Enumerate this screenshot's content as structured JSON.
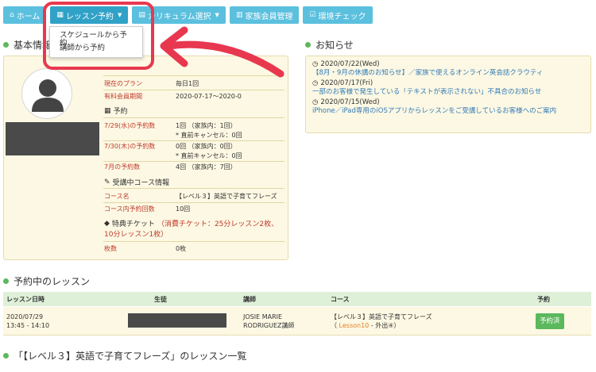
{
  "nav": {
    "home": "ホーム",
    "lesson_reservation": "レッスン予約",
    "curriculum": "カリキュラム選択",
    "family": "家族会員管理",
    "env_check": "環境チェック"
  },
  "dropdown": {
    "items": [
      "スケジュールから予約",
      "講師から予約"
    ]
  },
  "sections": {
    "basic_info": "基本情報",
    "news": "お知らせ",
    "upcoming": "予約中のレッスン",
    "lesson_list": "「【レベル３】英語で子育てフレーズ」のレッスン一覧"
  },
  "profile": {
    "plan_label": "現在のプラン",
    "plan_value": "毎日1回",
    "period_label": "有料会員期間",
    "period_value": "2020-07-17〜2020-0",
    "reservation_heading": "予約",
    "r1_label": "7/29(水)の予約数",
    "r1_value": "1回 （家族内：1回）",
    "r1_note": "* 直前キャンセル：0回",
    "r2_label": "7/30(木)の予約数",
    "r2_value": "0回 （家族内：0回）",
    "r2_note": "* 直前キャンセル：0回",
    "r3_label": "7月の予約数",
    "r3_value": "4回 （家族内：7回）",
    "course_heading": "受講中コース情報",
    "course_label": "コース名",
    "course_value": "【レベル３】英語で子育てフレーズ",
    "count_label": "コース内予約回数",
    "count_value": "10回",
    "ticket_heading": "特典チケット",
    "ticket_detail_1": "（消費チケット：25分レッスン2枚、",
    "ticket_detail_2": "10分レッスン1枚）",
    "sheets_label": "枚数",
    "sheets_value": "0枚"
  },
  "news": [
    {
      "date": "2020/07/22(Wed)",
      "title": "【8月・9月の休講のお知らせ】／家族で使えるオンライン英会話クラウティ"
    },
    {
      "date": "2020/07/17(Fri)",
      "title": "一部のお客様で発生している「テキストが表示されない」不具合のお知らせ"
    },
    {
      "date": "2020/07/15(Wed)",
      "title": "iPhone／iPad専用のiOSアプリからレッスンをご受講しているお客様へのご案内"
    }
  ],
  "table": {
    "headers": [
      "レッスン日時",
      "生徒",
      "講師",
      "コース",
      "予約"
    ],
    "row": {
      "date": "2020/07/29",
      "time": "13:45 - 14:10",
      "teacher_1": "JOSIE MARIE",
      "teacher_2": "RODRIGUEZ講師",
      "course": "【レベル３】英語で子育てフレーズ",
      "lesson_open": "（ ",
      "lesson": "Lesson10",
      "lesson_rest": " - 外出④）",
      "status": "予約済"
    }
  },
  "colors": {
    "nav": "#5bc0de",
    "panel": "#fcf8e3",
    "highlight": "#e8384f",
    "green": "#5cb85c"
  }
}
